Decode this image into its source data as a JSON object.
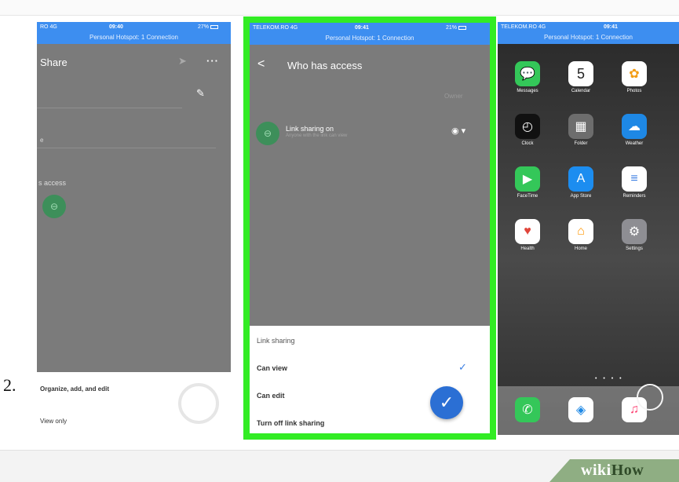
{
  "step_number": "2.",
  "watermark": {
    "brand_bold": "wiki",
    "brand_light": "How"
  },
  "left_phone": {
    "status": {
      "carrier": "RO  4G",
      "time": "09:40",
      "battery": "27%",
      "hotspot": "Personal Hotspot: 1 Connection"
    },
    "title": "Share",
    "send_icon": "➤",
    "more_icon": "···",
    "pencil_icon": "✎",
    "field_text": "e",
    "access_label": "s access",
    "link_icon": "⊖",
    "options": {
      "organize": "Organize, add, and edit",
      "view_only": "View only"
    }
  },
  "middle_phone": {
    "status": {
      "carrier": "TELEKOM.RO  4G",
      "time": "09:41",
      "battery": "21%",
      "hotspot": "Personal Hotspot: 1 Connection"
    },
    "back_icon": "<",
    "title": "Who has access",
    "owner_label": "Owner",
    "link_sharing": {
      "title": "Link sharing on",
      "subtitle": "Anyone with the link can view",
      "icon": "⊖",
      "eye_icon": "◉ ▾"
    },
    "sheet": {
      "header": "Link sharing",
      "items": [
        "Can view",
        "Can edit",
        "Turn off link sharing"
      ],
      "selected_check": "✓"
    },
    "fab_icon": "✓"
  },
  "right_phone": {
    "status": {
      "carrier": "TELEKOM.RO  4G",
      "time": "09:41",
      "hotspot": "Personal Hotspot: 1 Connection"
    },
    "apps": [
      {
        "label": "Messages",
        "icon": "💬",
        "color": "#34c759"
      },
      {
        "label": "Calendar",
        "icon": "5",
        "color": "#ffffff"
      },
      {
        "label": "Photos",
        "icon": "✿",
        "color": "#ffffff"
      },
      {
        "label": "Clock",
        "icon": "◴",
        "color": "#111111"
      },
      {
        "label": "Folder",
        "icon": "▦",
        "color": "#6d6d6d"
      },
      {
        "label": "Weather",
        "icon": "☁",
        "color": "#1e88e5"
      },
      {
        "label": "FaceTime",
        "icon": "▶",
        "color": "#34c759"
      },
      {
        "label": "App Store",
        "icon": "A",
        "color": "#1c8df0"
      },
      {
        "label": "Reminders",
        "icon": "≡",
        "color": "#ffffff"
      },
      {
        "label": "Health",
        "icon": "♥",
        "color": "#ffffff"
      },
      {
        "label": "Home",
        "icon": "⌂",
        "color": "#ffffff"
      },
      {
        "label": "Settings",
        "icon": "⚙",
        "color": "#8e8e93"
      }
    ],
    "page_dots": "• • • •",
    "dock": [
      {
        "name": "Phone",
        "icon": "✆",
        "color": "#34c759"
      },
      {
        "name": "Safari",
        "icon": "◈",
        "color": "#ffffff"
      },
      {
        "name": "Music",
        "icon": "♫",
        "color": "#ffffff"
      }
    ]
  }
}
